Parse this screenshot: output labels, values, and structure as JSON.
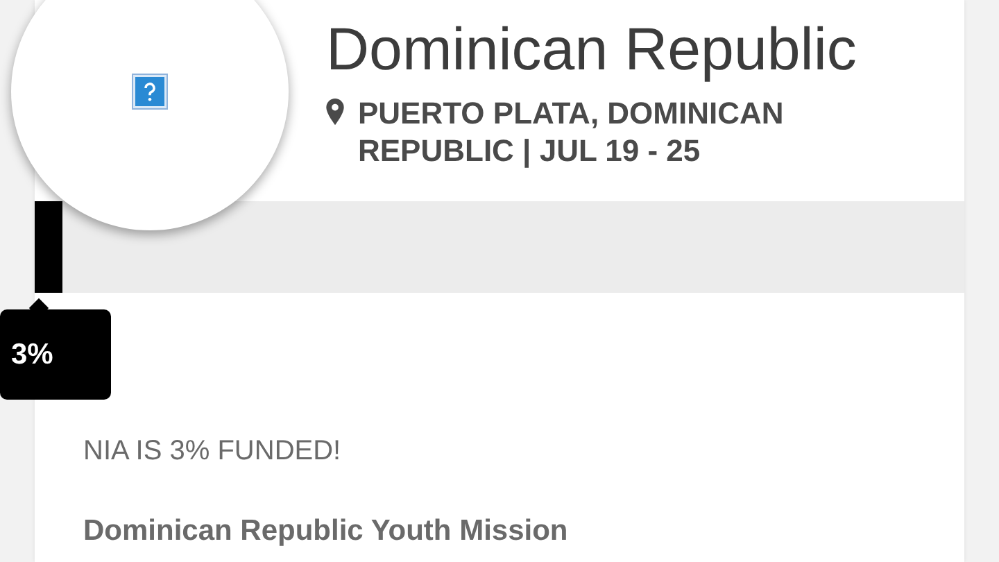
{
  "trip": {
    "title": "Dominican Republic",
    "location": "PUERTO PLATA, DOMINICAN REPUBLIC | JUL 19 - 25",
    "image": {
      "broken": true
    }
  },
  "funding": {
    "level": 0.03,
    "tooltip": "3%",
    "message": "NIA IS 3% FUNDED!"
  },
  "campaign": {
    "title": "Dominican Republic Youth Mission"
  }
}
